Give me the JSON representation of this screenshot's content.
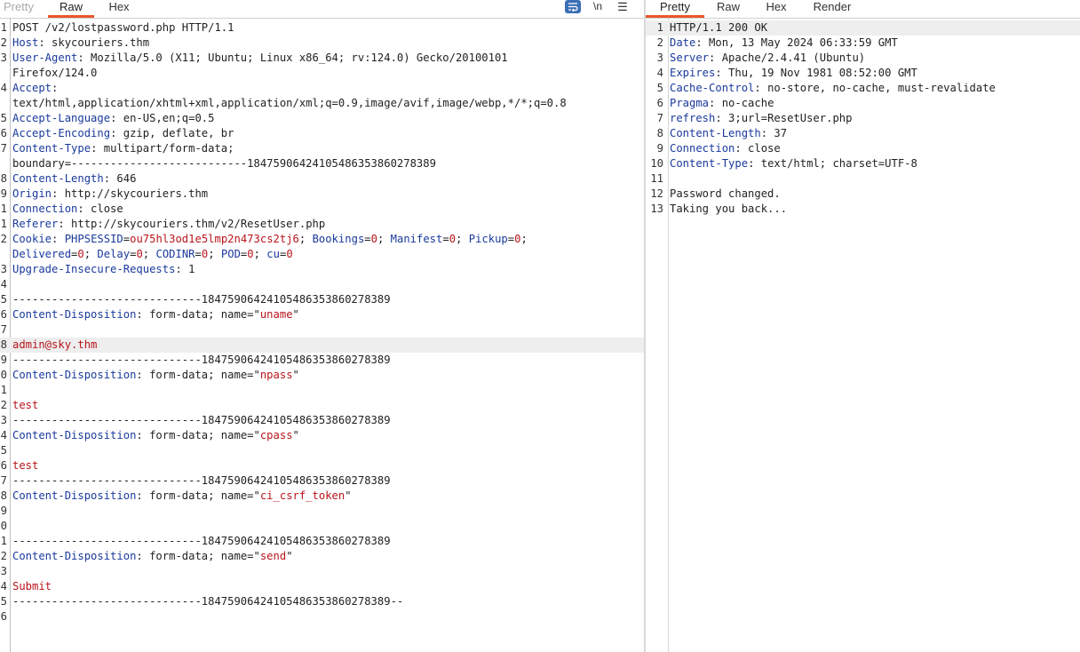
{
  "request": {
    "tabs": [
      "Pretty",
      "Raw",
      "Hex"
    ],
    "active_tab": "Raw",
    "tools": {
      "newline_label": "\\n",
      "menu_label": "☰"
    },
    "lines": [
      {
        "n": "1",
        "segs": [
          {
            "t": "v",
            "s": "POST /v2/lostpassword.php HTTP/1.1"
          }
        ]
      },
      {
        "n": "2",
        "segs": [
          {
            "t": "k",
            "s": "Host"
          },
          {
            "t": "v",
            "s": ": skycouriers.thm"
          }
        ]
      },
      {
        "n": "3",
        "segs": [
          {
            "t": "k",
            "s": "User-Agent"
          },
          {
            "t": "v",
            "s": ": Mozilla/5.0 (X11; Ubuntu; Linux x86_64; rv:124.0) Gecko/20100101"
          }
        ]
      },
      {
        "n": "",
        "segs": [
          {
            "t": "v",
            "s": "Firefox/124.0"
          }
        ]
      },
      {
        "n": "4",
        "segs": [
          {
            "t": "k",
            "s": "Accept"
          },
          {
            "t": "v",
            "s": ":"
          }
        ]
      },
      {
        "n": "",
        "segs": [
          {
            "t": "v",
            "s": "text/html,application/xhtml+xml,application/xml;q=0.9,image/avif,image/webp,*/*;q=0.8"
          }
        ]
      },
      {
        "n": "5",
        "segs": [
          {
            "t": "k",
            "s": "Accept-Language"
          },
          {
            "t": "v",
            "s": ": en-US,en;q=0.5"
          }
        ]
      },
      {
        "n": "6",
        "segs": [
          {
            "t": "k",
            "s": "Accept-Encoding"
          },
          {
            "t": "v",
            "s": ": gzip, deflate, br"
          }
        ]
      },
      {
        "n": "7",
        "segs": [
          {
            "t": "k",
            "s": "Content-Type"
          },
          {
            "t": "v",
            "s": ": multipart/form-data;"
          }
        ]
      },
      {
        "n": "",
        "segs": [
          {
            "t": "v",
            "s": "boundary=---------------------------184759064241054863538602783​89"
          }
        ]
      },
      {
        "n": "8",
        "segs": [
          {
            "t": "k",
            "s": "Content-Length"
          },
          {
            "t": "v",
            "s": ": 646"
          }
        ]
      },
      {
        "n": "9",
        "segs": [
          {
            "t": "k",
            "s": "Origin"
          },
          {
            "t": "v",
            "s": ": http://skycouriers.thm"
          }
        ]
      },
      {
        "n": "1",
        "segs": [
          {
            "t": "k",
            "s": "Connection"
          },
          {
            "t": "v",
            "s": ": close"
          }
        ]
      },
      {
        "n": "1",
        "segs": [
          {
            "t": "k",
            "s": "Referer"
          },
          {
            "t": "v",
            "s": ": http://skycouriers.thm/v2/ResetUser.php"
          }
        ]
      },
      {
        "n": "2",
        "segs": [
          {
            "t": "k",
            "s": "Cookie"
          },
          {
            "t": "v",
            "s": ": "
          },
          {
            "t": "k",
            "s": "PHPSESSID"
          },
          {
            "t": "v",
            "s": "="
          },
          {
            "t": "r",
            "s": "ou75hl3od1e5lmp2n473cs2tj6"
          },
          {
            "t": "v",
            "s": "; "
          },
          {
            "t": "k",
            "s": "Bookings"
          },
          {
            "t": "v",
            "s": "="
          },
          {
            "t": "r",
            "s": "0"
          },
          {
            "t": "v",
            "s": "; "
          },
          {
            "t": "k",
            "s": "Manifest"
          },
          {
            "t": "v",
            "s": "="
          },
          {
            "t": "r",
            "s": "0"
          },
          {
            "t": "v",
            "s": "; "
          },
          {
            "t": "k",
            "s": "Pickup"
          },
          {
            "t": "v",
            "s": "="
          },
          {
            "t": "r",
            "s": "0"
          },
          {
            "t": "v",
            "s": ";"
          }
        ]
      },
      {
        "n": "",
        "segs": [
          {
            "t": "k",
            "s": "Delivered"
          },
          {
            "t": "v",
            "s": "="
          },
          {
            "t": "r",
            "s": "0"
          },
          {
            "t": "v",
            "s": "; "
          },
          {
            "t": "k",
            "s": "Delay"
          },
          {
            "t": "v",
            "s": "="
          },
          {
            "t": "r",
            "s": "0"
          },
          {
            "t": "v",
            "s": "; "
          },
          {
            "t": "k",
            "s": "CODINR"
          },
          {
            "t": "v",
            "s": "="
          },
          {
            "t": "r",
            "s": "0"
          },
          {
            "t": "v",
            "s": "; "
          },
          {
            "t": "k",
            "s": "POD"
          },
          {
            "t": "v",
            "s": "="
          },
          {
            "t": "r",
            "s": "0"
          },
          {
            "t": "v",
            "s": "; "
          },
          {
            "t": "k",
            "s": "cu"
          },
          {
            "t": "v",
            "s": "="
          },
          {
            "t": "r",
            "s": "0"
          }
        ]
      },
      {
        "n": "3",
        "segs": [
          {
            "t": "k",
            "s": "Upgrade-Insecure-Requests"
          },
          {
            "t": "v",
            "s": ": 1"
          }
        ]
      },
      {
        "n": "4",
        "segs": []
      },
      {
        "n": "5",
        "segs": [
          {
            "t": "v",
            "s": "-----------------------------18475906424105486353860278389"
          }
        ]
      },
      {
        "n": "6",
        "segs": [
          {
            "t": "k",
            "s": "Content-Disposition"
          },
          {
            "t": "v",
            "s": ": form-data; name=\""
          },
          {
            "t": "r",
            "s": "uname"
          },
          {
            "t": "v",
            "s": "\""
          }
        ]
      },
      {
        "n": "7",
        "segs": []
      },
      {
        "n": "8",
        "segs": [
          {
            "t": "r",
            "s": "admin@sky.thm"
          }
        ],
        "hl": true
      },
      {
        "n": "9",
        "segs": [
          {
            "t": "v",
            "s": "-----------------------------18475906424105486353860278389"
          }
        ]
      },
      {
        "n": "0",
        "segs": [
          {
            "t": "k",
            "s": "Content-Disposition"
          },
          {
            "t": "v",
            "s": ": form-data; name=\""
          },
          {
            "t": "r",
            "s": "npass"
          },
          {
            "t": "v",
            "s": "\""
          }
        ]
      },
      {
        "n": "1",
        "segs": []
      },
      {
        "n": "2",
        "segs": [
          {
            "t": "r",
            "s": "test"
          }
        ]
      },
      {
        "n": "3",
        "segs": [
          {
            "t": "v",
            "s": "-----------------------------18475906424105486353860278389"
          }
        ]
      },
      {
        "n": "4",
        "segs": [
          {
            "t": "k",
            "s": "Content-Disposition"
          },
          {
            "t": "v",
            "s": ": form-data; name=\""
          },
          {
            "t": "r",
            "s": "cpass"
          },
          {
            "t": "v",
            "s": "\""
          }
        ]
      },
      {
        "n": "5",
        "segs": []
      },
      {
        "n": "6",
        "segs": [
          {
            "t": "r",
            "s": "test"
          }
        ]
      },
      {
        "n": "7",
        "segs": [
          {
            "t": "v",
            "s": "-----------------------------18475906424105486353860278389"
          }
        ]
      },
      {
        "n": "8",
        "segs": [
          {
            "t": "k",
            "s": "Content-Disposition"
          },
          {
            "t": "v",
            "s": ": form-data; name=\""
          },
          {
            "t": "r",
            "s": "ci_csrf_token"
          },
          {
            "t": "v",
            "s": "\""
          }
        ]
      },
      {
        "n": "9",
        "segs": []
      },
      {
        "n": "0",
        "segs": []
      },
      {
        "n": "1",
        "segs": [
          {
            "t": "v",
            "s": "-----------------------------18475906424105486353860278389"
          }
        ]
      },
      {
        "n": "2",
        "segs": [
          {
            "t": "k",
            "s": "Content-Disposition"
          },
          {
            "t": "v",
            "s": ": form-data; name=\""
          },
          {
            "t": "r",
            "s": "send"
          },
          {
            "t": "v",
            "s": "\""
          }
        ]
      },
      {
        "n": "3",
        "segs": []
      },
      {
        "n": "4",
        "segs": [
          {
            "t": "r",
            "s": "Submit"
          }
        ]
      },
      {
        "n": "5",
        "segs": [
          {
            "t": "v",
            "s": "-----------------------------18475906424105486353860278389--"
          }
        ]
      },
      {
        "n": "6",
        "segs": []
      }
    ]
  },
  "response": {
    "tabs": [
      "Pretty",
      "Raw",
      "Hex",
      "Render"
    ],
    "active_tab": "Pretty",
    "lines": [
      {
        "n": "1",
        "segs": [
          {
            "t": "v",
            "s": "HTTP/1.1 200 OK"
          }
        ],
        "hl": true
      },
      {
        "n": "2",
        "segs": [
          {
            "t": "k",
            "s": "Date"
          },
          {
            "t": "v",
            "s": ": Mon, 13 May 2024 06:33:59 GMT"
          }
        ]
      },
      {
        "n": "3",
        "segs": [
          {
            "t": "k",
            "s": "Server"
          },
          {
            "t": "v",
            "s": ": Apache/2.4.41 (Ubuntu)"
          }
        ]
      },
      {
        "n": "4",
        "segs": [
          {
            "t": "k",
            "s": "Expires"
          },
          {
            "t": "v",
            "s": ": Thu, 19 Nov 1981 08:52:00 GMT"
          }
        ]
      },
      {
        "n": "5",
        "segs": [
          {
            "t": "k",
            "s": "Cache-Control"
          },
          {
            "t": "v",
            "s": ": no-store, no-cache, must-revalidate"
          }
        ]
      },
      {
        "n": "6",
        "segs": [
          {
            "t": "k",
            "s": "Pragma"
          },
          {
            "t": "v",
            "s": ": no-cache"
          }
        ]
      },
      {
        "n": "7",
        "segs": [
          {
            "t": "k",
            "s": "refresh"
          },
          {
            "t": "v",
            "s": ": 3;url=ResetUser.php"
          }
        ]
      },
      {
        "n": "8",
        "segs": [
          {
            "t": "k",
            "s": "Content-Length"
          },
          {
            "t": "v",
            "s": ": 37"
          }
        ]
      },
      {
        "n": "9",
        "segs": [
          {
            "t": "k",
            "s": "Connection"
          },
          {
            "t": "v",
            "s": ": close"
          }
        ]
      },
      {
        "n": "10",
        "segs": [
          {
            "t": "k",
            "s": "Content-Type"
          },
          {
            "t": "v",
            "s": ": text/html; charset=UTF-8"
          }
        ]
      },
      {
        "n": "11",
        "segs": []
      },
      {
        "n": "12",
        "segs": [
          {
            "t": "v",
            "s": "Password changed."
          }
        ]
      },
      {
        "n": "13",
        "segs": [
          {
            "t": "v",
            "s": "Taking you back..."
          }
        ]
      }
    ]
  },
  "colors": {
    "accent": "#e8582c",
    "key": "#1a3a9c",
    "value_red": "#b8151c",
    "wrap_button": "#3b6fb6"
  }
}
